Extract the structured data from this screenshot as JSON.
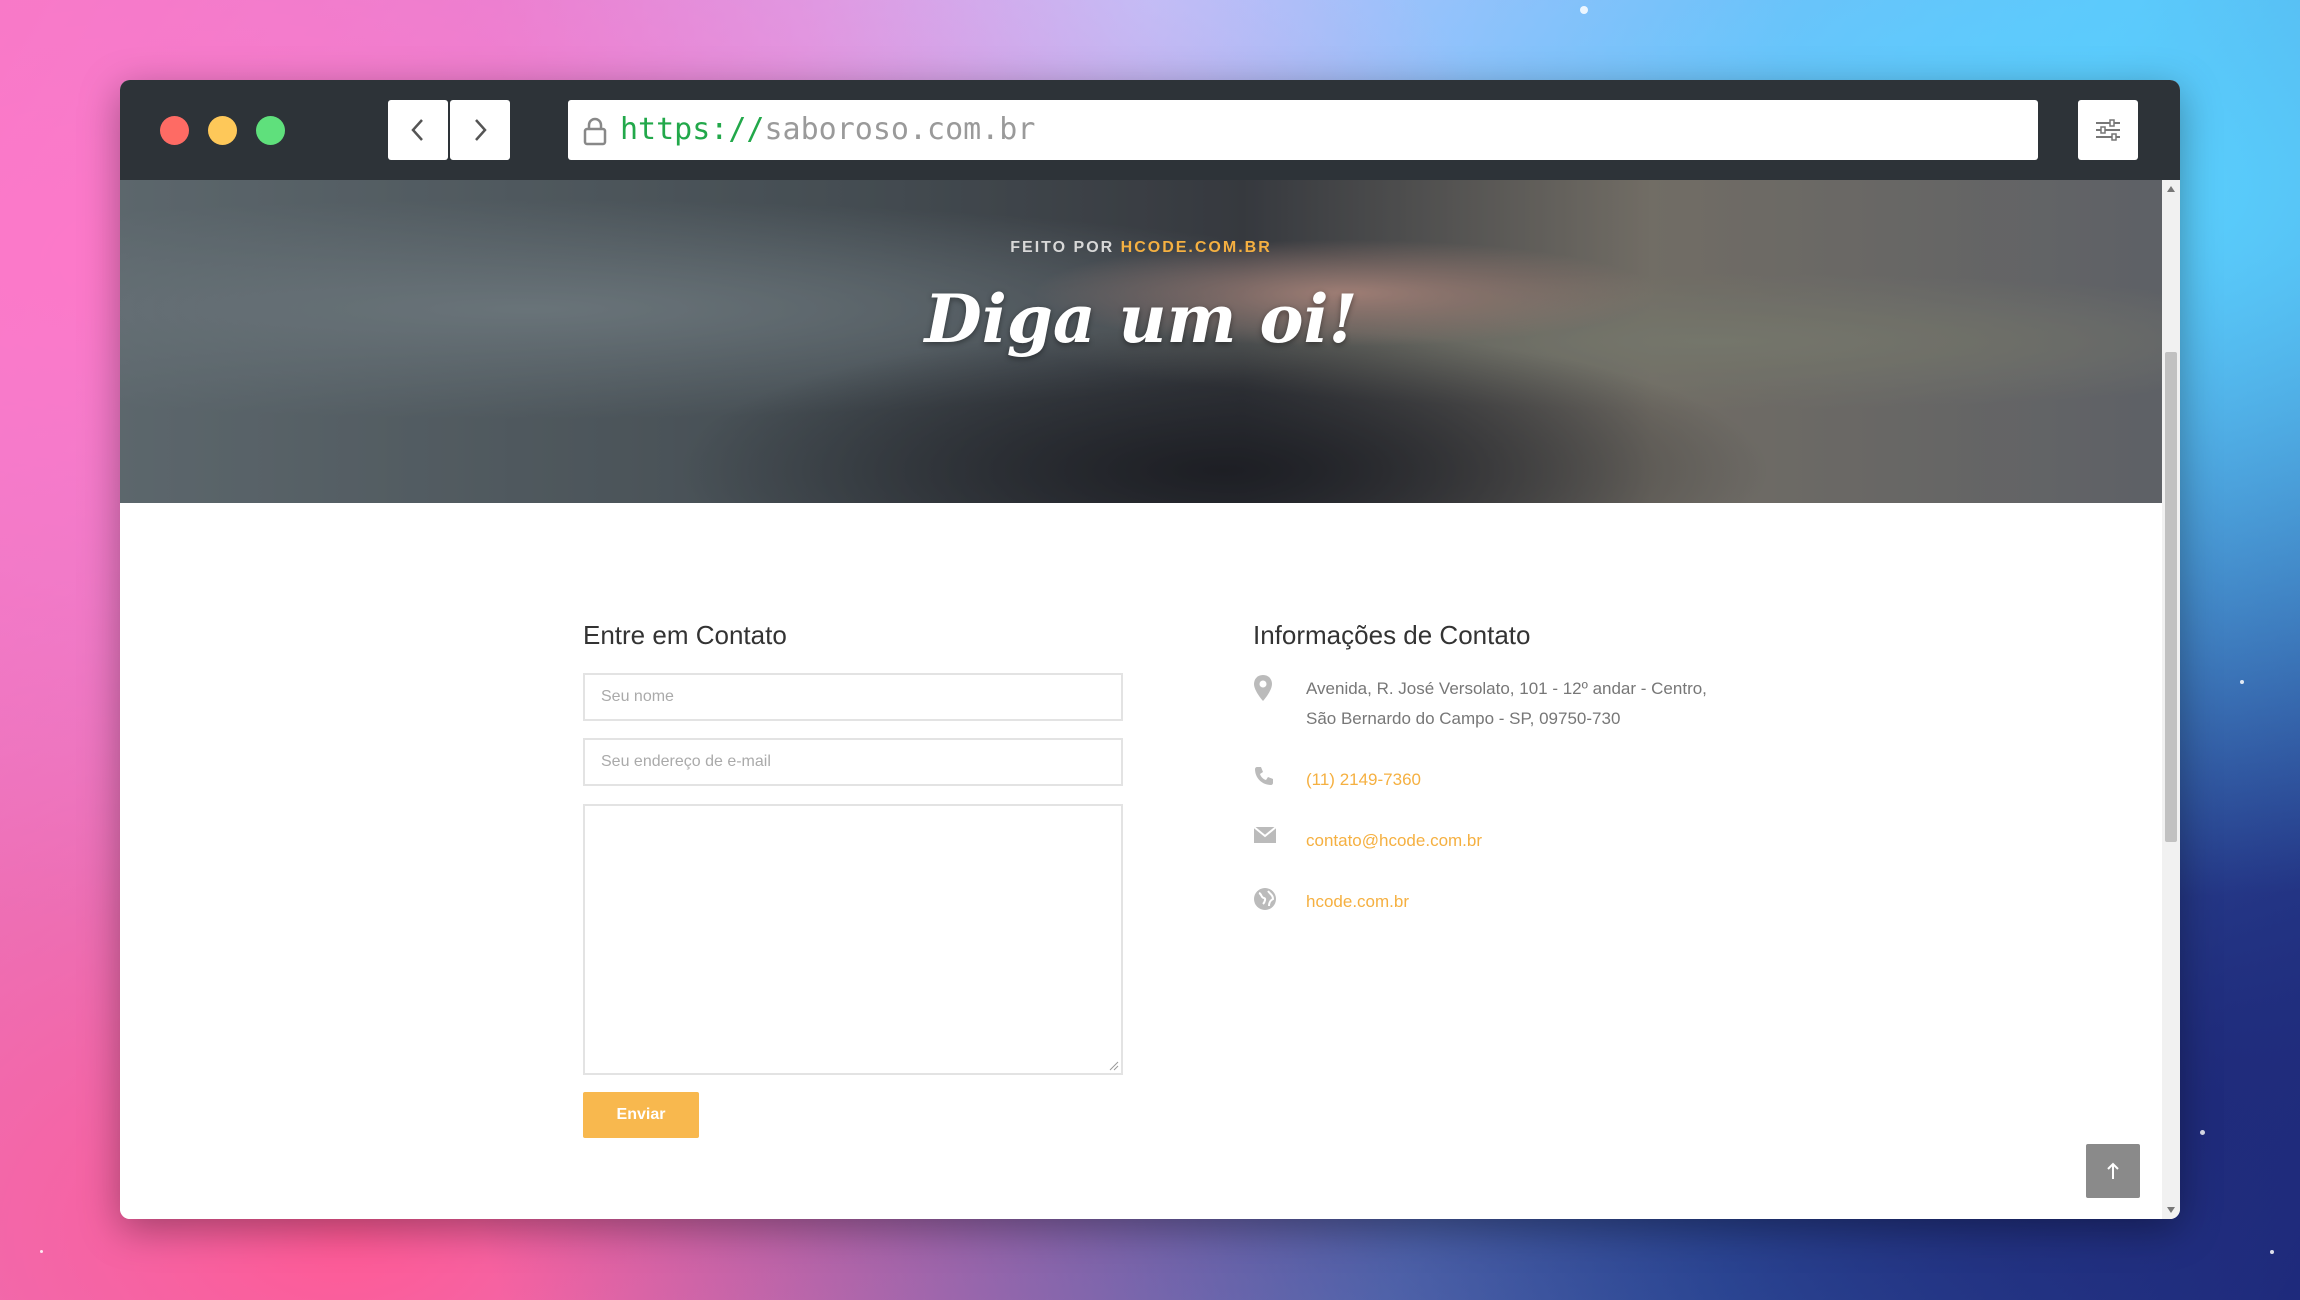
{
  "browser": {
    "url_protocol": "https://",
    "url_host": "saboroso.com.br"
  },
  "hero": {
    "made_by_prefix": "FEITO POR",
    "made_by_brand": "HCODE.COM.BR",
    "title": "Diga um oi!"
  },
  "contact_form": {
    "title": "Entre em Contato",
    "name_placeholder": "Seu nome",
    "email_placeholder": "Seu endereço de e-mail",
    "submit_label": "Enviar"
  },
  "contact_info": {
    "title": "Informações de Contato",
    "address_line1": "Avenida, R. José Versolato, 101 - 12º andar - Centro,",
    "address_line2": "São Bernardo do Campo - SP, 09750-730",
    "phone": "(11) 2149-7360",
    "email": "contato@hcode.com.br",
    "website": "hcode.com.br"
  },
  "colors": {
    "accent": "#f8b84e",
    "toolbar": "#2d3338"
  },
  "icons": [
    "lock-icon",
    "chevron-left-icon",
    "chevron-right-icon",
    "sliders-icon",
    "map-pin-icon",
    "phone-icon",
    "envelope-icon",
    "globe-icon",
    "arrow-up-icon"
  ]
}
